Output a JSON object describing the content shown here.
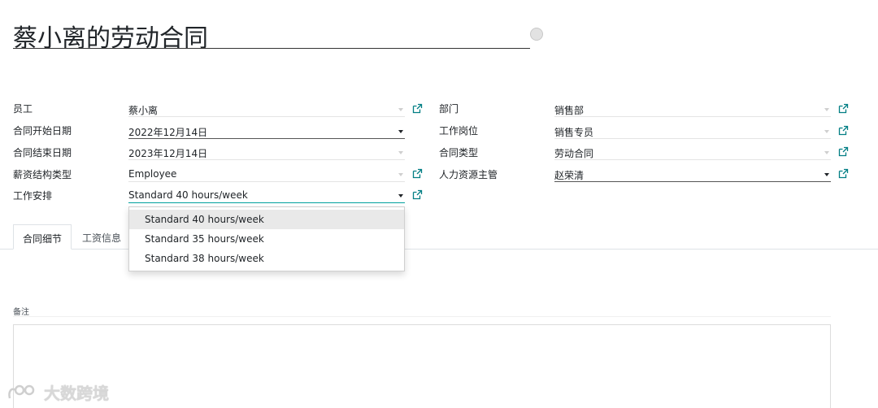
{
  "record": {
    "title": "蔡小离的劳动合同"
  },
  "left_fields": [
    {
      "label": "员工",
      "value": "蔡小离"
    },
    {
      "label": "合同开始日期",
      "value": "2022年12月14日"
    },
    {
      "label": "合同结束日期",
      "value": "2023年12月14日"
    },
    {
      "label": "薪资结构类型",
      "value": "Employee"
    },
    {
      "label": "工作安排",
      "value": "Standard 40 hours/week"
    }
  ],
  "right_fields": [
    {
      "label": "部门",
      "value": "销售部"
    },
    {
      "label": "工作岗位",
      "value": "销售专员"
    },
    {
      "label": "合同类型",
      "value": "劳动合同"
    },
    {
      "label": "人力资源主管",
      "value": "赵荣清"
    }
  ],
  "dropdown": {
    "options": [
      "Standard 40 hours/week",
      "Standard 35 hours/week",
      "Standard 38 hours/week"
    ],
    "highlighted_index": 0
  },
  "tabs": [
    {
      "label": "合同细节",
      "active": true
    },
    {
      "label": "工资信息",
      "active": false
    }
  ],
  "notes": {
    "label": "备注"
  },
  "watermark": {
    "text": "大数跨境"
  },
  "colors": {
    "accent": "#00a09d",
    "link_icon": "#017e84"
  }
}
